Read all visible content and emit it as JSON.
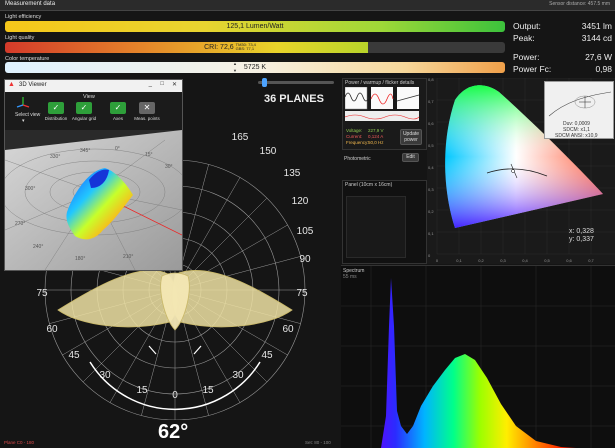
{
  "titlebar": {
    "title": "Measurement data",
    "right": "Sensor distance: 457.5 mm"
  },
  "light_efficiency": {
    "label": "Light efficiency",
    "value": "125,1 Lumen/Watt",
    "fill": 1.0
  },
  "light_quality": {
    "label": "Light quality",
    "value": "CRI: 72,6",
    "sub1": "TM30: 73,4",
    "sub2": "GBS: 77,1",
    "fill": 0.726
  },
  "color_temperature": {
    "label": "Color temperature",
    "value": "5725 K",
    "up": "▲",
    "down": "▼"
  },
  "stats": {
    "output_label": "Output:",
    "output_value": "3451 lm",
    "peak_label": "Peak:",
    "peak_value": "3144 cd",
    "power_label": "Power:",
    "power_value": "27,6 W",
    "powerfc_label": "Power Fc:",
    "powerfc_value": "0,98"
  },
  "planes": {
    "label": "36 PLANES",
    "slider": 0.05
  },
  "polar": {
    "angle_label": "62°",
    "ticks": [
      "165",
      "150",
      "135",
      "120",
      "105",
      "90",
      "75",
      "60",
      "45",
      "30",
      "15",
      "0",
      "15",
      "30",
      "45",
      "60",
      "75"
    ]
  },
  "viewer3d": {
    "title": "3D Viewer",
    "view_label": "View",
    "select_view": "Select view",
    "buttons": [
      "Distribution",
      "Angular grid",
      "Axes",
      "Meas. points"
    ],
    "controls": [
      "_",
      "□",
      "✕"
    ],
    "labels": [
      "330°",
      "345°",
      "0°",
      "15°",
      "30°",
      "300°",
      "270°",
      "240°",
      "180°",
      "210°"
    ]
  },
  "power_panel": {
    "title": "Power / warmup / flicker details",
    "voltage_label": "Voltage:",
    "voltage_value": "227,9 V",
    "current_label": "Current:",
    "current_value": "0,124 A",
    "frequency_label": "Frequency:",
    "frequency_value": "50,0 Hz",
    "update_button": "Update power"
  },
  "photometric": {
    "label": "Photometric",
    "edit_button": "Edit"
  },
  "panel_size": {
    "label": "Panel (10cm x 16cm)"
  },
  "cie": {
    "duv": "Duv: 0,0009",
    "sdcm": "SDCM: x1,1",
    "sdcm_ansi": "SDCM ANSI: x10,9",
    "x": "x: 0,328",
    "y": "y: 0,337",
    "x_ticks": [
      "0",
      "0,1",
      "0,2",
      "0,3",
      "0,4",
      "0,5",
      "0,6",
      "0,7"
    ],
    "y_ticks": [
      "0,8",
      "0,7",
      "0,6",
      "0,5",
      "0,4",
      "0,3",
      "0,2",
      "0,1",
      "0"
    ]
  },
  "spectrum": {
    "title": "Spectrum",
    "sub": "55 ms"
  },
  "footer": {
    "left": "Plane C0 - 180",
    "right": "Set: 80 - 100"
  },
  "colors": {
    "accent": "#ffffff",
    "background": "#151515"
  }
}
